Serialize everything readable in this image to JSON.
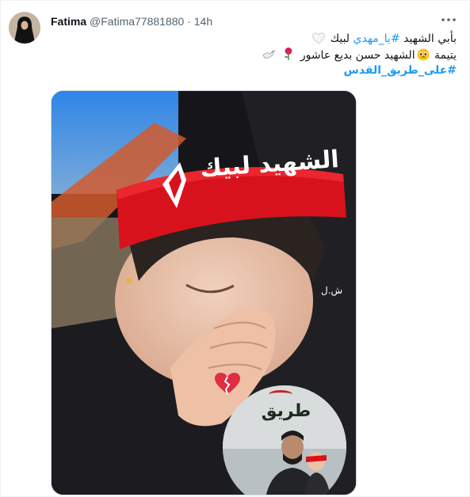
{
  "tweet": {
    "author_name": "Fatima",
    "author_handle": "@Fatima77881880",
    "separator": "·",
    "time": "14h",
    "line1_part1": "بأبي الشهيد ",
    "line1_hashtag": "#يا_مهدي",
    "line1_part2": " لبيك",
    "line2_part1": "يتيمة ",
    "line2_part2": "الشهيد حسن بديع عاشور",
    "line3_hashtag": "#على_طريق_القدس"
  },
  "media": {
    "headband_text": "الشهيد لبيك",
    "watermark": "ش.ل",
    "inset_text": "طريق"
  },
  "icons": {
    "white_heart": "white-heart-icon",
    "pleading_face": "pleading-face-icon",
    "rose": "rose-icon",
    "dove": "dove-icon",
    "broken_heart": "broken-heart-icon",
    "more": "more-dots-icon"
  },
  "colors": {
    "hashtag": "#1d9bf0",
    "headband": "#d8121c",
    "secondary_text": "#536471"
  }
}
